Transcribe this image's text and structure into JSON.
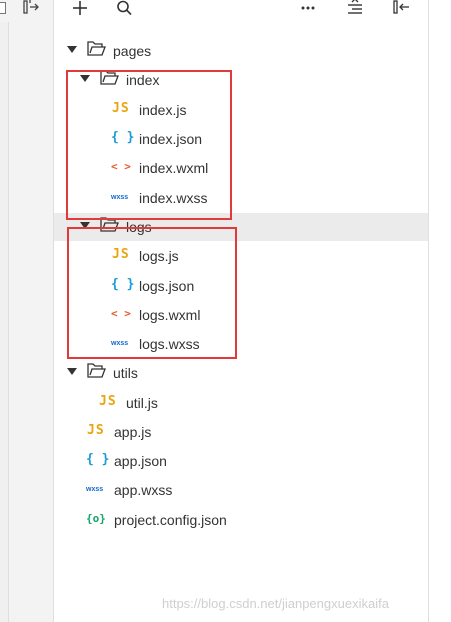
{
  "toolbar": {
    "icons": [
      "add-icon",
      "search-icon",
      "more-icon",
      "collapse-all-icon",
      "hide-tree-icon"
    ],
    "more_glyph": "···"
  },
  "tree": {
    "pages_label": "pages",
    "index_label": "index",
    "index_js": "index.js",
    "index_json": "index.json",
    "index_wxml": "index.wxml",
    "index_wxss": "index.wxss",
    "logs_label": "logs",
    "logs_js": "logs.js",
    "logs_json": "logs.json",
    "logs_wxml": "logs.wxml",
    "logs_wxss": "logs.wxss",
    "utils_label": "utils",
    "util_js": "util.js",
    "app_js": "app.js",
    "app_json": "app.json",
    "app_wxss": "app.wxss",
    "project_config": "project.config.json"
  },
  "icons": {
    "js": "JS",
    "json": "{ }",
    "wxml": "< >",
    "wxss": "wxss",
    "config": "{o}"
  },
  "colors": {
    "highlight_box": "#e03a3a",
    "js": "#e8a512",
    "json": "#1a9bd7",
    "wxml": "#e85a2a",
    "wxss": "#1468c9",
    "config": "#11a56a",
    "selected_row": "#ebebeb"
  },
  "watermark": "https://blog.csdn.net/jianpengxuexikaifa"
}
